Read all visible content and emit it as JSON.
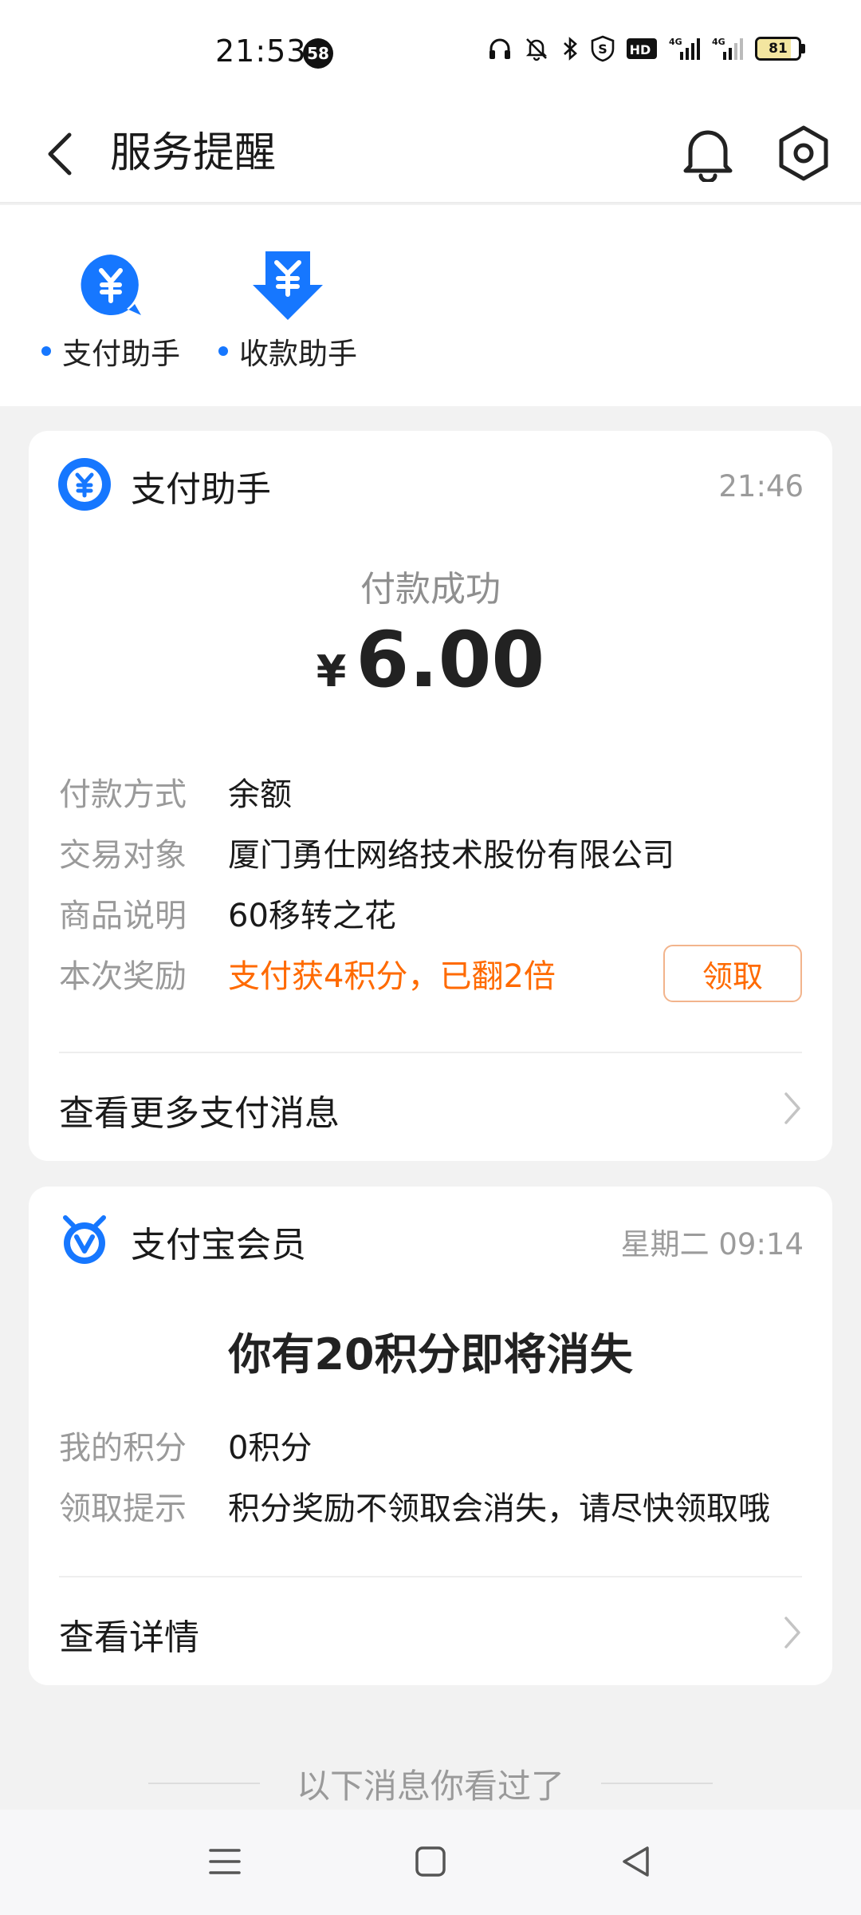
{
  "status_bar": {
    "time": "21:53",
    "notification_count": "58",
    "network_1": "4G",
    "network_2": "4G",
    "hd_badge": "HD",
    "battery": "81",
    "battery_level": 0.81,
    "icons": [
      "headphones-icon",
      "bell-muted-icon",
      "bluetooth-icon",
      "shield-icon",
      "hd-icon",
      "signal-icon",
      "signal-icon",
      "battery-icon"
    ]
  },
  "header": {
    "title": "服务提醒"
  },
  "shortcuts": [
    {
      "label": "支付助手",
      "icon": "yuan-chat-icon"
    },
    {
      "label": "收款助手",
      "icon": "yuan-download-icon"
    }
  ],
  "payment_card": {
    "sender": "支付助手",
    "time": "21:46",
    "status": "付款成功",
    "currency": "¥",
    "amount": "6.00",
    "rows": [
      {
        "key": "付款方式",
        "value": "余额"
      },
      {
        "key": "交易对象",
        "value": "厦门勇仕网络技术股份有限公司"
      },
      {
        "key": "商品说明",
        "value": "60移转之花"
      },
      {
        "key": "本次奖励",
        "value": "支付获4积分，已翻2倍"
      }
    ],
    "claim_button": "领取",
    "more_link": "查看更多支付消息"
  },
  "member_card": {
    "sender": "支付宝会员",
    "time": "星期二 09:14",
    "headline": "你有20积分即将消失",
    "rows": [
      {
        "key": "我的积分",
        "value": "0积分"
      },
      {
        "key": "领取提示",
        "value": "积分奖励不领取会消失，请尽快领取哦"
      }
    ],
    "more_link": "查看详情"
  },
  "seen_separator": "以下消息你看过了",
  "colors": {
    "brand_blue": "#1677ff",
    "accent_orange": "#ff6a00",
    "background": "#f2f2f2"
  }
}
